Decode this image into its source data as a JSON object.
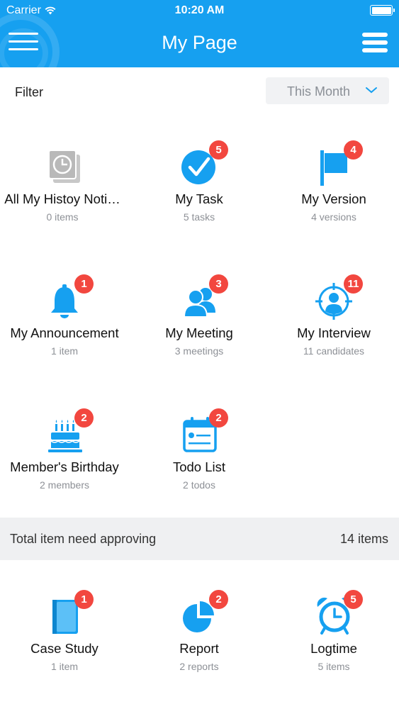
{
  "status_bar": {
    "carrier": "Carrier",
    "time": "10:20 AM"
  },
  "header": {
    "title": "My Page"
  },
  "filter": {
    "label": "Filter",
    "selected": "This Month"
  },
  "tiles": [
    {
      "label": "All My Histoy Noti…",
      "count": "0 items",
      "icon": "history-notification-icon"
    },
    {
      "label": "My Task",
      "count": "5 tasks",
      "icon": "check-circle-icon",
      "badge": "5"
    },
    {
      "label": "My Version",
      "count": "4 versions",
      "icon": "flag-icon",
      "badge": "4"
    },
    {
      "label": "My Announcement",
      "count": "1 item",
      "icon": "bell-icon",
      "badge": "1"
    },
    {
      "label": "My Meeting",
      "count": "3 meetings",
      "icon": "people-icon",
      "badge": "3"
    },
    {
      "label": "My Interview",
      "count": "11 candidates",
      "icon": "target-person-icon",
      "badge": "11"
    },
    {
      "label": "Member's Birthday",
      "count": "2 members",
      "icon": "cake-icon",
      "badge": "2"
    },
    {
      "label": "Todo List",
      "count": "2 todos",
      "icon": "calendar-list-icon",
      "badge": "2"
    }
  ],
  "approval": {
    "label": "Total item need approving",
    "count": "14 items",
    "tiles": [
      {
        "label": "Case Study",
        "count": "1 item",
        "icon": "book-icon",
        "badge": "1"
      },
      {
        "label": "Report",
        "count": "2 reports",
        "icon": "pie-chart-icon",
        "badge": "2"
      },
      {
        "label": "Logtime",
        "count": "5 items",
        "icon": "alarm-clock-icon",
        "badge": "5"
      }
    ]
  },
  "colors": {
    "primary": "#16a0f0",
    "badge": "#f2473f",
    "muted_text": "#8d9096",
    "section_bg": "#eff0f2"
  }
}
